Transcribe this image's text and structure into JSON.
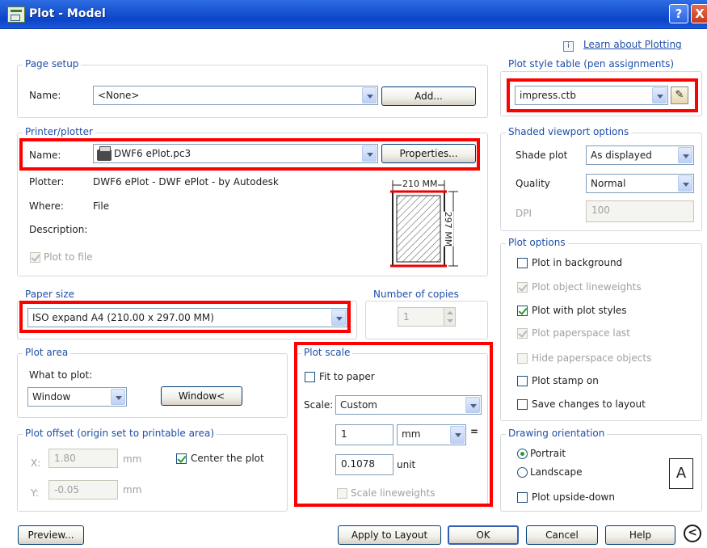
{
  "window": {
    "title": "Plot - Model",
    "help_btn": "?",
    "close_btn": "X"
  },
  "learn_link": "Learn about Plotting",
  "page_setup": {
    "group": "Page setup",
    "name_label": "Name:",
    "name_value": "<None>",
    "add_button": "Add..."
  },
  "printer": {
    "group": "Printer/plotter",
    "name_label": "Name:",
    "name_value": "DWF6 ePlot.pc3",
    "properties_button": "Properties...",
    "plotter_label": "Plotter:",
    "plotter_value": "DWF6 ePlot - DWF ePlot - by Autodesk",
    "where_label": "Where:",
    "where_value": "File",
    "description_label": "Description:",
    "plot_to_file": "Plot to file",
    "preview_width": "210 MM",
    "preview_height": "297 MM"
  },
  "paper_size": {
    "group": "Paper size",
    "value": "ISO expand A4 (210.00 x 297.00 MM)"
  },
  "copies": {
    "group": "Number of copies",
    "value": "1"
  },
  "plot_area": {
    "group": "Plot area",
    "what_label": "What to plot:",
    "what_value": "Window",
    "window_button": "Window<"
  },
  "plot_offset": {
    "group": "Plot offset (origin set to printable area)",
    "x_label": "X:",
    "x_value": "1.80",
    "x_unit": "mm",
    "y_label": "Y:",
    "y_value": "-0.05",
    "y_unit": "mm",
    "center_label": "Center the plot"
  },
  "plot_scale": {
    "group": "Plot scale",
    "fit_label": "Fit to paper",
    "scale_label": "Scale:",
    "scale_value": "Custom",
    "num_value": "1",
    "unit_select": "mm",
    "equals": "=",
    "den_value": "0.1078",
    "den_unit": "unit",
    "lineweights_label": "Scale lineweights"
  },
  "style_table": {
    "group": "Plot style table (pen assignments)",
    "value": "impress.ctb"
  },
  "shaded": {
    "group": "Shaded viewport options",
    "shade_label": "Shade plot",
    "shade_value": "As displayed",
    "quality_label": "Quality",
    "quality_value": "Normal",
    "dpi_label": "DPI",
    "dpi_value": "100"
  },
  "options": {
    "group": "Plot options",
    "background": "Plot in background",
    "lineweights": "Plot object lineweights",
    "with_styles": "Plot with plot styles",
    "paperspace_last": "Plot paperspace last",
    "hide_objects": "Hide paperspace objects",
    "stamp": "Plot stamp on",
    "save_changes": "Save changes to layout"
  },
  "orientation": {
    "group": "Drawing orientation",
    "portrait": "Portrait",
    "landscape": "Landscape",
    "upside_down": "Plot upside-down",
    "icon_letter": "A"
  },
  "footer": {
    "preview": "Preview...",
    "apply": "Apply to Layout",
    "ok": "OK",
    "cancel": "Cancel",
    "help": "Help",
    "more": "<"
  }
}
